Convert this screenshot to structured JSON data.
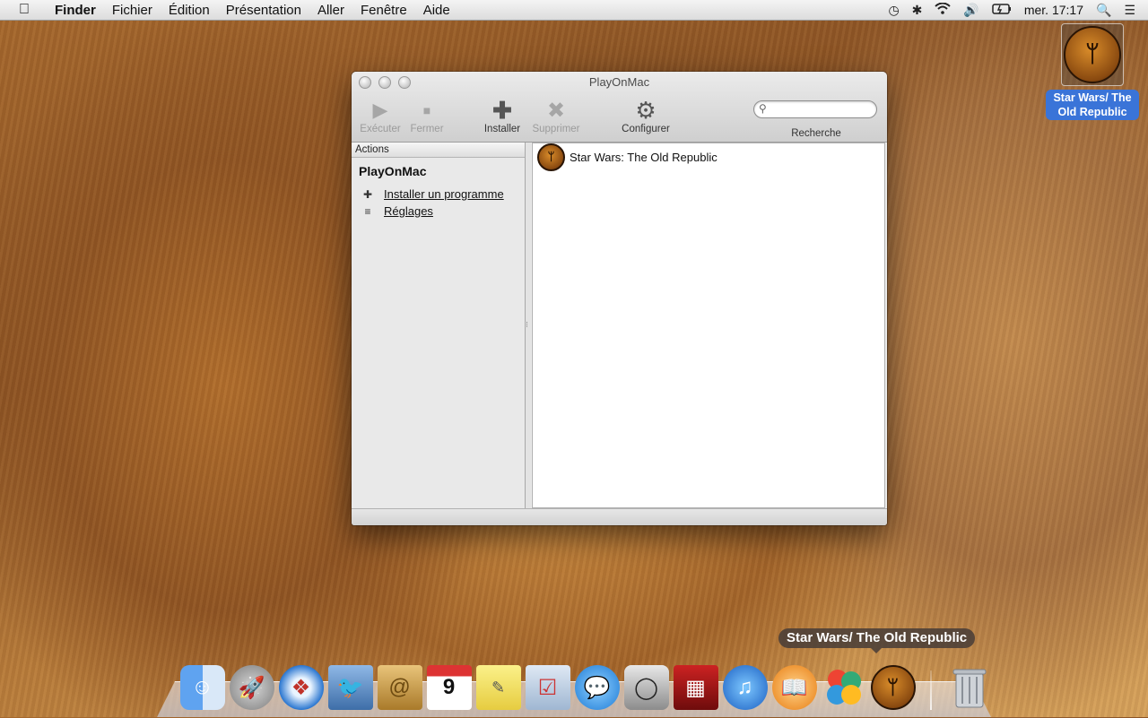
{
  "menubar": {
    "app": "Finder",
    "items": [
      "Fichier",
      "Édition",
      "Présentation",
      "Aller",
      "Fenêtre",
      "Aide"
    ],
    "clock": "mer. 17:17"
  },
  "desktop_icon": {
    "label": "Star Wars/ The Old Republic"
  },
  "window": {
    "title": "PlayOnMac",
    "toolbar": {
      "run": "Exécuter",
      "close": "Fermer",
      "install": "Installer",
      "remove": "Supprimer",
      "configure": "Configurer",
      "search_label": "Recherche",
      "search_value": ""
    },
    "sidebar": {
      "header": "Actions",
      "title": "PlayOnMac",
      "links": [
        "Installer un programme",
        "Réglages"
      ]
    },
    "apps": [
      "Star Wars: The Old Republic"
    ]
  },
  "dock": {
    "tooltip": "Star Wars/ The Old Republic"
  }
}
